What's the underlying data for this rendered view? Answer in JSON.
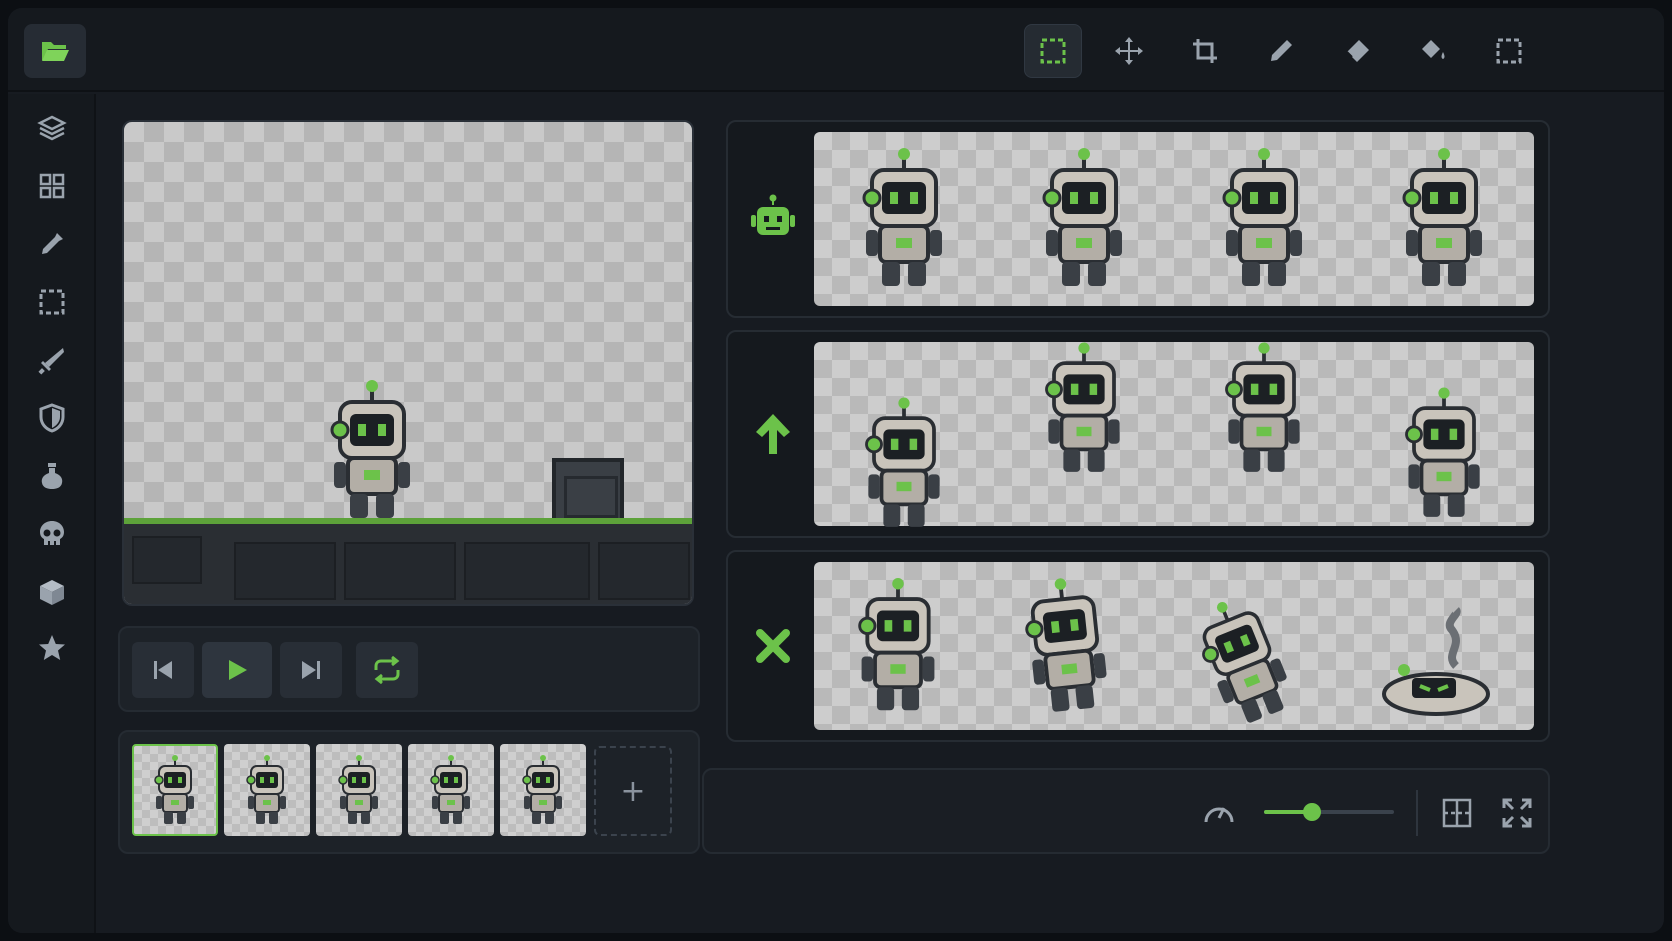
{
  "colors": {
    "accent": "#6cc24a",
    "icon": "#9aa3ad",
    "panel": "#1d2228",
    "background": "#171b21"
  },
  "topbar": {
    "folder_icon": "folder-open-icon",
    "tools": [
      {
        "icon": "marquee-select-icon",
        "active": true
      },
      {
        "icon": "move-icon",
        "active": false
      },
      {
        "icon": "crop-icon",
        "active": false
      },
      {
        "icon": "pencil-icon",
        "active": false
      },
      {
        "icon": "eraser-icon",
        "active": false
      },
      {
        "icon": "paint-bucket-icon",
        "active": false
      },
      {
        "icon": "dashed-select-icon",
        "active": false
      }
    ]
  },
  "sidebar": {
    "items": [
      {
        "icon": "layers-icon"
      },
      {
        "icon": "grid-icon"
      },
      {
        "icon": "eyedropper-icon"
      },
      {
        "icon": "selection-icon"
      },
      {
        "icon": "sword-icon"
      },
      {
        "icon": "shield-icon"
      },
      {
        "icon": "potion-icon"
      },
      {
        "icon": "skull-icon"
      },
      {
        "icon": "cube-icon"
      },
      {
        "icon": "star-icon"
      }
    ]
  },
  "playback": {
    "buttons": [
      {
        "icon": "skip-back-icon"
      },
      {
        "icon": "play-icon",
        "active": true
      },
      {
        "icon": "skip-forward-icon"
      },
      {
        "icon": "loop-icon"
      }
    ]
  },
  "frames": {
    "count": 5,
    "selected_index": 0,
    "add_label": "+"
  },
  "animations": [
    {
      "icon": "robot-icon",
      "frames": 4
    },
    {
      "icon": "arrow-up-icon",
      "frames": 4
    },
    {
      "icon": "close-x-icon",
      "frames": 4
    }
  ],
  "controls": {
    "speed_icon": "speedometer-icon",
    "speed_level": 0.37,
    "grid_icon": "grid-toggle-icon",
    "fullscreen_icon": "fullscreen-icon"
  }
}
